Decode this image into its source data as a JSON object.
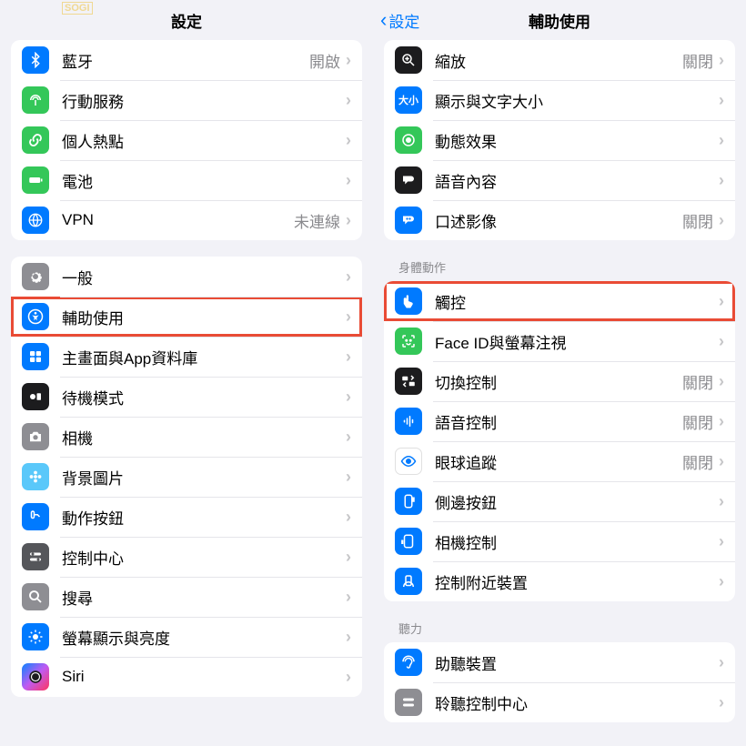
{
  "watermark": {
    "text": "",
    "tag": "SOGI"
  },
  "left": {
    "title": "設定",
    "group1": [
      {
        "label": "藍牙",
        "value": "開啟",
        "iconBg": "bg-blue",
        "glyph": "bt"
      },
      {
        "label": "行動服務",
        "value": "",
        "iconBg": "bg-green",
        "glyph": "antenna"
      },
      {
        "label": "個人熱點",
        "value": "",
        "iconBg": "bg-green",
        "glyph": "link"
      },
      {
        "label": "電池",
        "value": "",
        "iconBg": "bg-green",
        "glyph": "battery"
      },
      {
        "label": "VPN",
        "value": "未連線",
        "iconBg": "bg-blue",
        "glyph": "globe"
      }
    ],
    "group2": [
      {
        "label": "一般",
        "value": "",
        "iconBg": "bg-gray",
        "glyph": "gear"
      },
      {
        "label": "輔助使用",
        "value": "",
        "iconBg": "bg-blue",
        "glyph": "access",
        "highlight": true
      },
      {
        "label": "主畫面與App資料庫",
        "value": "",
        "iconBg": "bg-blue",
        "glyph": "home"
      },
      {
        "label": "待機模式",
        "value": "",
        "iconBg": "bg-black",
        "glyph": "standby"
      },
      {
        "label": "相機",
        "value": "",
        "iconBg": "bg-gray",
        "glyph": "camera"
      },
      {
        "label": "背景圖片",
        "value": "",
        "iconBg": "bg-lightblue",
        "glyph": "flower"
      },
      {
        "label": "動作按鈕",
        "value": "",
        "iconBg": "bg-blue",
        "glyph": "action"
      },
      {
        "label": "控制中心",
        "value": "",
        "iconBg": "bg-darkgray",
        "glyph": "toggles"
      },
      {
        "label": "搜尋",
        "value": "",
        "iconBg": "bg-gray",
        "glyph": "search"
      },
      {
        "label": "螢幕顯示與亮度",
        "value": "",
        "iconBg": "bg-blue",
        "glyph": "sun"
      },
      {
        "label": "Siri",
        "value": "",
        "iconBg": "bg-siri",
        "glyph": "siri"
      }
    ]
  },
  "right": {
    "back": "設定",
    "title": "輔助使用",
    "group1": [
      {
        "label": "縮放",
        "value": "關閉",
        "iconBg": "bg-black",
        "glyph": "zoom"
      },
      {
        "label": "顯示與文字大小",
        "value": "",
        "iconBg": "bg-blue",
        "glyph": "textsize"
      },
      {
        "label": "動態效果",
        "value": "",
        "iconBg": "bg-green",
        "glyph": "motion"
      },
      {
        "label": "語音內容",
        "value": "",
        "iconBg": "bg-black",
        "glyph": "speech"
      },
      {
        "label": "口述影像",
        "value": "關閉",
        "iconBg": "bg-blue",
        "glyph": "audio"
      }
    ],
    "section2": "身體動作",
    "group2": [
      {
        "label": "觸控",
        "value": "",
        "iconBg": "bg-blue",
        "glyph": "touch",
        "highlight": true
      },
      {
        "label": "Face ID與螢幕注視",
        "value": "",
        "iconBg": "bg-green",
        "glyph": "face"
      },
      {
        "label": "切換控制",
        "value": "關閉",
        "iconBg": "bg-black",
        "glyph": "switch"
      },
      {
        "label": "語音控制",
        "value": "關閉",
        "iconBg": "bg-blue",
        "glyph": "voice"
      },
      {
        "label": "眼球追蹤",
        "value": "關閉",
        "iconBg": "bg-white",
        "glyph": "eye"
      },
      {
        "label": "側邊按鈕",
        "value": "",
        "iconBg": "bg-blue",
        "glyph": "side"
      },
      {
        "label": "相機控制",
        "value": "",
        "iconBg": "bg-blue",
        "glyph": "camctl"
      },
      {
        "label": "控制附近裝置",
        "value": "",
        "iconBg": "bg-blue",
        "glyph": "nearby"
      }
    ],
    "section3": "聽力",
    "group3": [
      {
        "label": "助聽裝置",
        "value": "",
        "iconBg": "bg-blue",
        "glyph": "hearing"
      },
      {
        "label": "聆聽控制中心",
        "value": "",
        "iconBg": "bg-gray",
        "glyph": "listen"
      }
    ]
  }
}
